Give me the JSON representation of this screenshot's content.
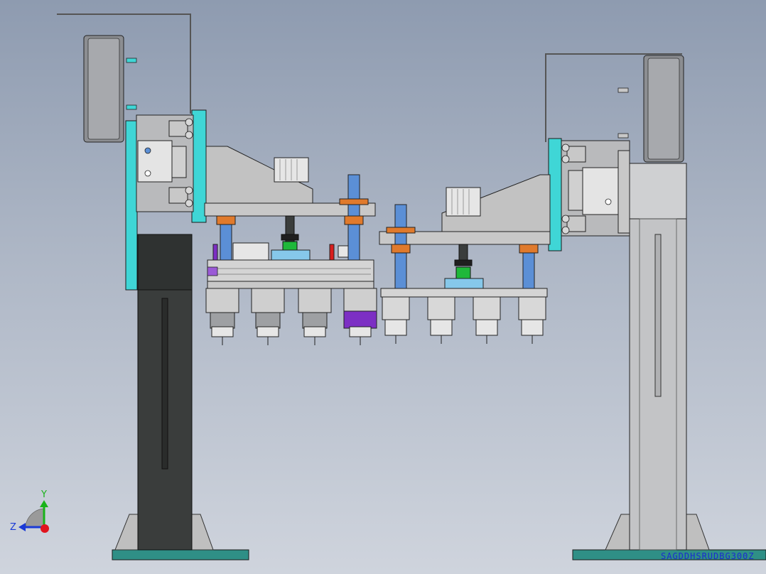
{
  "viewport": {
    "background_top": "#8e9bb0",
    "background_bottom": "#cfd4dd"
  },
  "axes": {
    "y_label": "Y",
    "z_label": "Z",
    "y_color": "#19b319",
    "z_color": "#1a3ad6",
    "origin_color": "#e0141e"
  },
  "colors": {
    "frame_dark": "#3a3d3c",
    "steel": "#c6c6c6",
    "steel_dark": "#8c8e92",
    "cyan_plate": "#3fd6d6",
    "orange_bushing": "#e07a2c",
    "blue_guide": "#5b8fd6",
    "green_cylinder": "#1fb83a",
    "purple_block": "#7c2fc4",
    "light_blue_plate": "#86c8ea",
    "red_marker": "#d81e1e",
    "base_teal": "#2f8f86"
  },
  "watermark": {
    "text": "SAGDDHSRUDBG300Z"
  }
}
